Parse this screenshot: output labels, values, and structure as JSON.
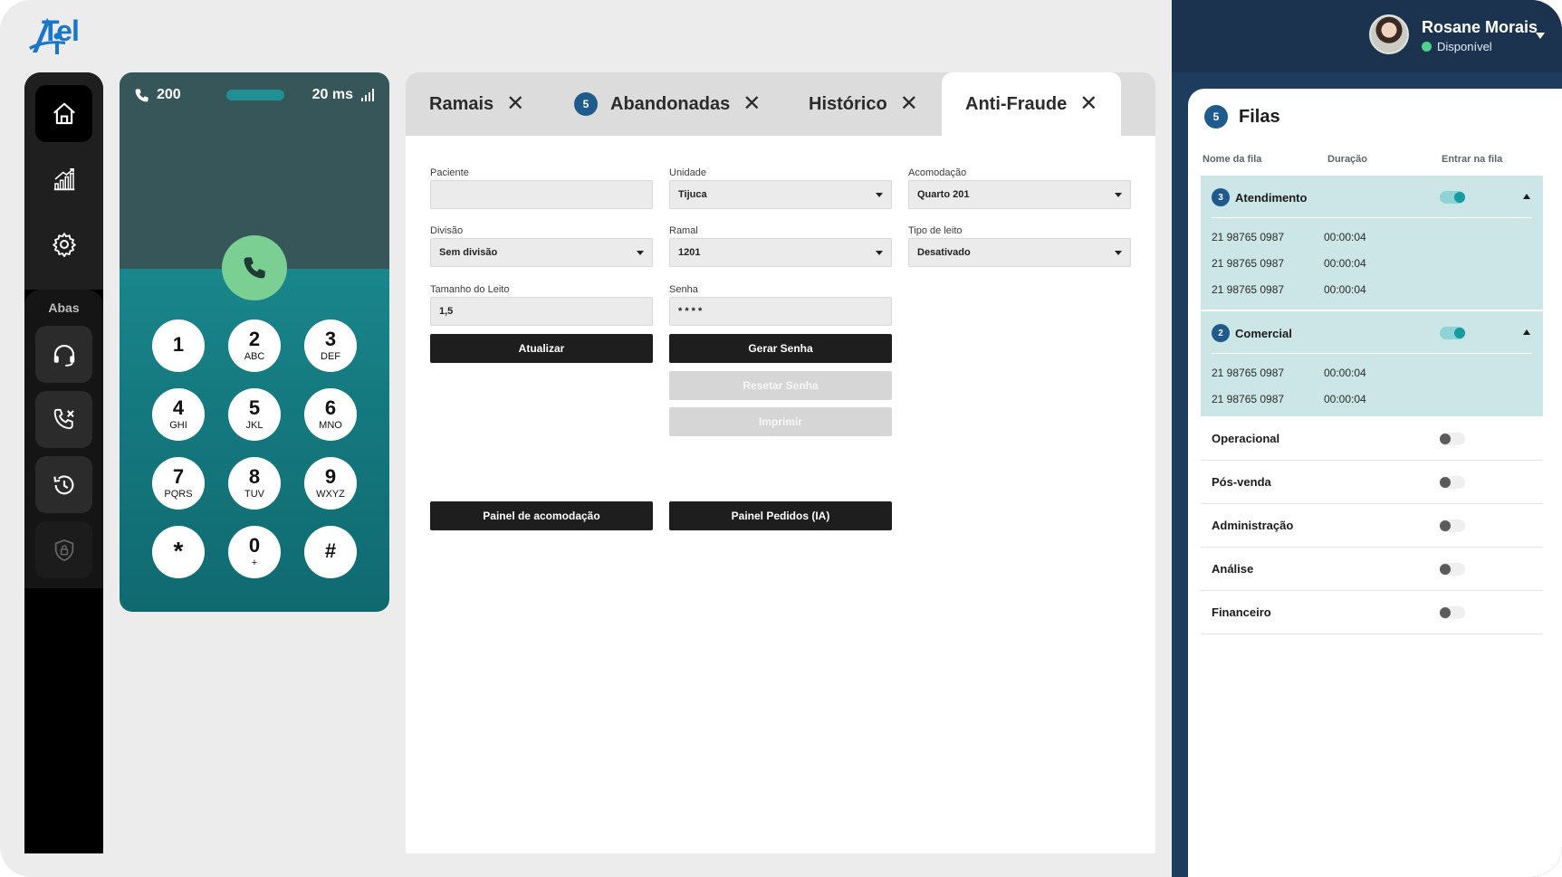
{
  "brand": {
    "logo_text": "Tel",
    "logo_color": "#1976c9"
  },
  "nav": {
    "section_label": "Abas",
    "items": [
      {
        "icon": "home-icon"
      },
      {
        "icon": "chart-icon"
      },
      {
        "icon": "gear-icon"
      },
      {
        "icon": "headset-icon"
      },
      {
        "icon": "call-missed-icon"
      },
      {
        "icon": "history-icon"
      },
      {
        "icon": "shield-lock-icon"
      }
    ]
  },
  "dialer": {
    "extension": "200",
    "latency": "20 ms",
    "keys": [
      {
        "digit": "1",
        "letters": ""
      },
      {
        "digit": "2",
        "letters": "ABC"
      },
      {
        "digit": "3",
        "letters": "DEF"
      },
      {
        "digit": "4",
        "letters": "GHI"
      },
      {
        "digit": "5",
        "letters": "JKL"
      },
      {
        "digit": "6",
        "letters": "MNO"
      },
      {
        "digit": "7",
        "letters": "PQRS"
      },
      {
        "digit": "8",
        "letters": "TUV"
      },
      {
        "digit": "9",
        "letters": "WXYZ"
      },
      {
        "digit": "*",
        "letters": ""
      },
      {
        "digit": "0",
        "letters": "+"
      },
      {
        "digit": "#",
        "letters": ""
      }
    ]
  },
  "tabs": [
    {
      "label": "Ramais",
      "badge": ""
    },
    {
      "label": "Abandonadas",
      "badge": "5"
    },
    {
      "label": "Histórico",
      "badge": ""
    },
    {
      "label": "Anti-Fraude",
      "badge": "",
      "active": true
    }
  ],
  "form": {
    "paciente": {
      "label": "Paciente",
      "value": ""
    },
    "unidade": {
      "label": "Unidade",
      "value": "Tijuca"
    },
    "acomodacao": {
      "label": "Acomodação",
      "value": "Quarto 201"
    },
    "divisao": {
      "label": "Divisão",
      "value": "Sem divisão"
    },
    "ramal": {
      "label": "Ramal",
      "value": "1201"
    },
    "tipo_leito": {
      "label": "Tipo de leito",
      "value": "Desativado"
    },
    "tamanho_leito": {
      "label": "Tamanho do Leito",
      "value": "1,5"
    },
    "senha": {
      "label": "Senha",
      "value": "* * * *"
    },
    "buttons": {
      "atualizar": "Atualizar",
      "gerar_senha": "Gerar Senha",
      "resetar_senha": "Resetar Senha",
      "imprimir": "Imprimir",
      "painel_acomodacao": "Painel de acomodação",
      "painel_pedidos": "Painel Pedidos (IA)"
    }
  },
  "user": {
    "name": "Rosane Morais",
    "status": "Disponível",
    "status_color": "#4fd18b"
  },
  "queues": {
    "title": "Filas",
    "count": "5",
    "headers": {
      "name": "Nome da fila",
      "duration": "Duração",
      "join": "Entrar na fila"
    },
    "groups": [
      {
        "name": "Atendimento",
        "count": "3",
        "enabled": true,
        "calls": [
          {
            "number": "21 98765 0987",
            "duration": "00:00:04"
          },
          {
            "number": "21 98765 0987",
            "duration": "00:00:04"
          },
          {
            "number": "21 98765 0987",
            "duration": "00:00:04"
          }
        ]
      },
      {
        "name": "Comercial",
        "count": "2",
        "enabled": true,
        "calls": [
          {
            "number": "21 98765 0987",
            "duration": "00:00:04"
          },
          {
            "number": "21 98765 0987",
            "duration": "00:00:04"
          }
        ]
      }
    ],
    "others": [
      {
        "name": "Operacional",
        "enabled": false
      },
      {
        "name": "Pós-venda",
        "enabled": false
      },
      {
        "name": "Administração",
        "enabled": false
      },
      {
        "name": "Análise",
        "enabled": false
      },
      {
        "name": "Financeiro",
        "enabled": false
      }
    ]
  },
  "colors": {
    "accent_teal": "#179aa0",
    "navy": "#1e3d5e",
    "badge_blue": "#1e5a8c",
    "call_green": "#7ccf93"
  }
}
